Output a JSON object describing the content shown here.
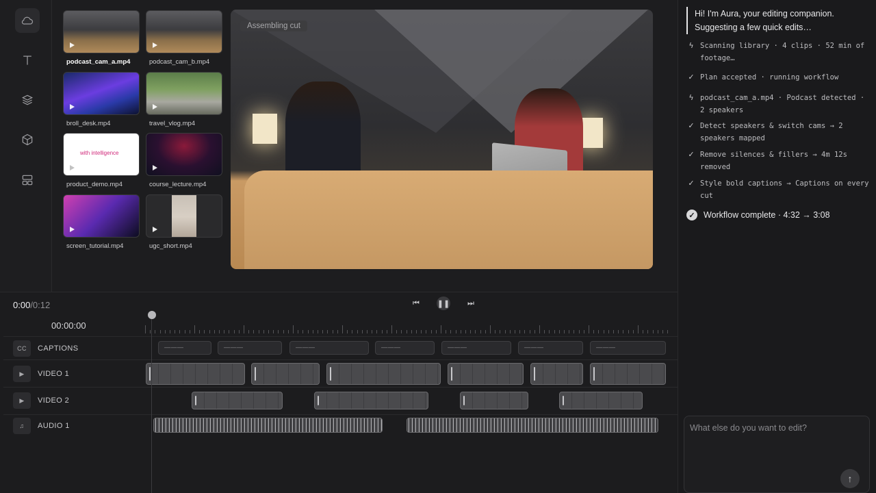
{
  "library": {
    "clips": [
      {
        "name": "podcast_cam_a.mp4",
        "selected": true
      },
      {
        "name": "podcast_cam_b.mp4",
        "selected": false
      },
      {
        "name": "broll_desk.mp4",
        "selected": false
      },
      {
        "name": "travel_vlog.mp4",
        "selected": false
      },
      {
        "name": "product_demo.mp4",
        "selected": false
      },
      {
        "name": "course_lecture.mp4",
        "selected": false
      },
      {
        "name": "screen_tutorial.mp4",
        "selected": false
      },
      {
        "name": "ugc_short.mp4",
        "selected": false
      }
    ],
    "demo_thumb_text": "with intelligence"
  },
  "sidebar": {
    "icons": [
      "cloud-icon",
      "text-icon",
      "layers-icon",
      "cube-icon",
      "layout-icon"
    ]
  },
  "preview": {
    "badge": "Assembling cut"
  },
  "chat": {
    "greeting": "Hi! I'm Aura, your editing companion. Suggesting a few quick edits…",
    "steps": [
      {
        "icon": "bolt-icon",
        "text": "Scanning library · 4 clips · 52 min of footage…"
      },
      {
        "icon": "check-icon",
        "text": "Plan accepted · running workflow"
      },
      {
        "icon": "bolt-icon",
        "text": "podcast_cam_a.mp4 · Podcast detected · 2 speakers"
      },
      {
        "icon": "check-icon",
        "text": "Detect speakers & switch cams → 2 speakers mapped"
      },
      {
        "icon": "check-icon",
        "text": "Remove silences & fillers → 4m 12s removed"
      },
      {
        "icon": "check-icon",
        "text": "Style bold captions → Captions on every cut"
      }
    ],
    "complete": "Workflow complete · 4:32 → 3:08",
    "input_placeholder": "What else do you want to edit?"
  },
  "timeline": {
    "current_time": "0:00",
    "total_time": "/0:12",
    "ruler_time": "00:00:00",
    "tracks": [
      {
        "icon": "CC",
        "label": "CAPTIONS"
      },
      {
        "icon": "▶",
        "label": "VIDEO 1"
      },
      {
        "icon": "▶",
        "label": "VIDEO 2"
      },
      {
        "icon": "♫",
        "label": "AUDIO 1"
      }
    ]
  },
  "colors": {
    "background": "#1d1d1f",
    "panel": "#1a1a1c",
    "accent": "#e8e8ea"
  }
}
